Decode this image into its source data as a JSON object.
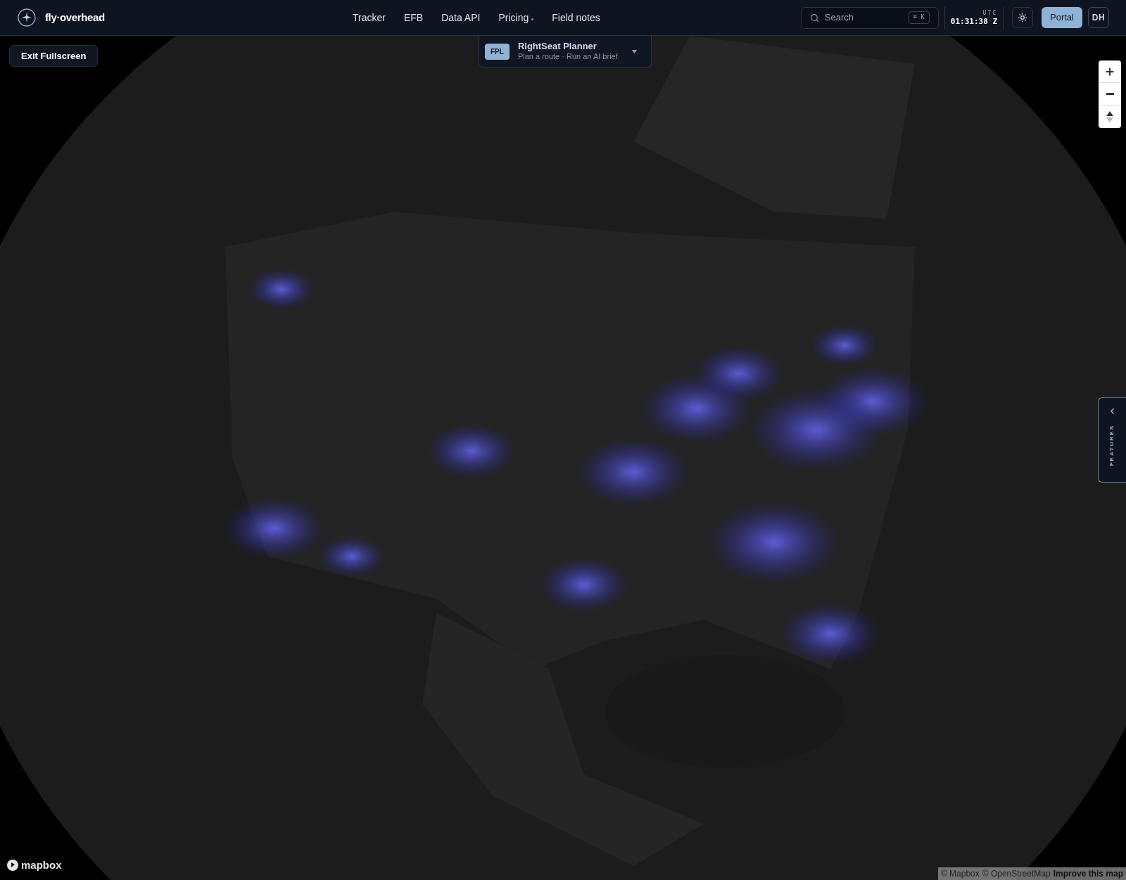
{
  "header": {
    "brand": "fly·overhead",
    "nav": [
      {
        "label": "Tracker",
        "kind": "link"
      },
      {
        "label": "EFB",
        "kind": "link"
      },
      {
        "label": "Data API",
        "kind": "link"
      },
      {
        "label": "Pricing",
        "kind": "menu"
      },
      {
        "label": "Field notes",
        "kind": "link"
      }
    ],
    "search": {
      "placeholder": "Search",
      "shortcut": "⌘ K"
    },
    "clock": {
      "zone": "UTC",
      "time": "01:31:38 Z"
    },
    "portal_button": "Portal",
    "avatar": "DH"
  },
  "map": {
    "kind": "picture",
    "exit_button": "Exit Fullscreen",
    "planner": {
      "badge": "FPL",
      "title": "RightSeat Planner",
      "subtitle": "Plan a route · Run an AI brief"
    },
    "features_tab": "FEATURES",
    "logo": "mapbox",
    "attribution": [
      "© Mapbox",
      "© OpenStreetMap"
    ],
    "improve_link": "Improve this map"
  }
}
